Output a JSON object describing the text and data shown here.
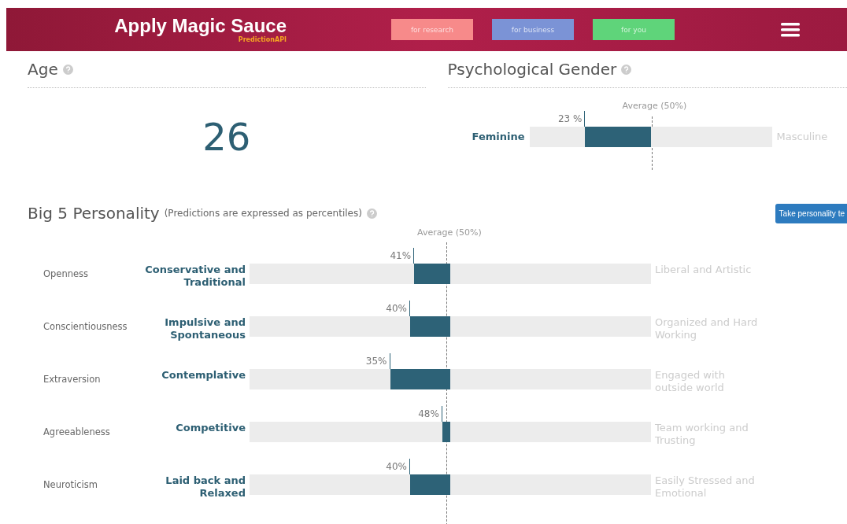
{
  "header": {
    "title": "Apply Magic Sauce",
    "subtitle": "PredictionAPI",
    "nav_buttons": [
      {
        "label": "for research",
        "color": "#f78a8a"
      },
      {
        "label": "for business",
        "color": "#7b93d6"
      },
      {
        "label": "for you",
        "color": "#5fd47a"
      }
    ]
  },
  "age": {
    "title": "Age",
    "value": "26"
  },
  "gender": {
    "title": "Psychological Gender",
    "average_label": "Average (50%)",
    "left_label": "Feminine",
    "right_label": "Masculine",
    "reading": "23 %",
    "level": 0.23
  },
  "big5": {
    "title": "Big 5 Personality",
    "note": "(Predictions are expressed as percentiles)",
    "button": "Take personality te",
    "average_label": "Average (50%)",
    "traits": [
      {
        "name": "Openness",
        "left_label": "Conservative and Traditional",
        "right_label": "Liberal and Artistic",
        "reading": "41%",
        "level": 0.41
      },
      {
        "name": "Conscientiousness",
        "left_label": "Impulsive and Spontaneous",
        "right_label": "Organized and Hard Working",
        "reading": "40%",
        "level": 0.4
      },
      {
        "name": "Extraversion",
        "left_label": "Contemplative",
        "right_label": "Engaged with outside world",
        "reading": "35%",
        "level": 0.35
      },
      {
        "name": "Agreeableness",
        "left_label": "Competitive",
        "right_label": "Team working and Trusting",
        "reading": "48%",
        "level": 0.48
      },
      {
        "name": "Neuroticism",
        "left_label": "Laid back and Relaxed",
        "right_label": "Easily Stressed and Emotional",
        "reading": "40%",
        "level": 0.4
      }
    ]
  }
}
